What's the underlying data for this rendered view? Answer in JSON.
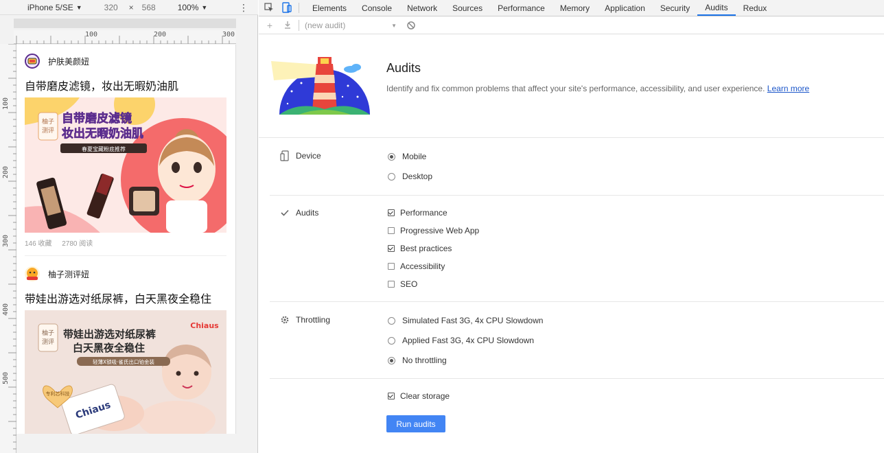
{
  "device_toolbar": {
    "device": "iPhone 5/SE",
    "width": "320",
    "times": "×",
    "height": "568",
    "zoom": "100%"
  },
  "ruler": {
    "h_labels": [
      "100",
      "200",
      "300"
    ],
    "v_labels": [
      "100",
      "200",
      "300",
      "400",
      "500"
    ]
  },
  "articles": [
    {
      "author": "护肤美颜妞",
      "title": "自带磨皮滤镜，妆出无暇奶油肌",
      "image": {
        "badge": "柚子测评",
        "headline_line1": "自带磨皮滤镜",
        "headline_line2": "妆出无暇奶油肌",
        "tagline": "春夏宝藏粉底推荐"
      },
      "stats": {
        "favorites": "146 收藏",
        "reads": "2780 阅读"
      }
    },
    {
      "author": "柚子测评妞",
      "title": "带娃出游选对纸尿裤，白天黑夜全稳住",
      "image": {
        "badge": "柚子测评",
        "brand": "Chiaus",
        "headline_line1": "带娃出游选对纸尿裤",
        "headline_line2": "白天黑夜全稳住",
        "tagline": "轻薄X锁吸·雀氏出口铂金装",
        "seal": "专利芯科技"
      }
    }
  ],
  "devtools": {
    "tabs": [
      "Elements",
      "Console",
      "Network",
      "Sources",
      "Performance",
      "Memory",
      "Application",
      "Security",
      "Audits",
      "Redux"
    ],
    "active_tab": "Audits",
    "audit_select": "(new audit)",
    "title": "Audits",
    "description": "Identify and fix common problems that affect your site's performance, accessibility, and user experience.",
    "learn_more": "Learn more",
    "device_section": {
      "label": "Device",
      "options": [
        {
          "label": "Mobile",
          "selected": true
        },
        {
          "label": "Desktop",
          "selected": false
        }
      ]
    },
    "audits_section": {
      "label": "Audits",
      "options": [
        {
          "label": "Performance",
          "checked": true
        },
        {
          "label": "Progressive Web App",
          "checked": false
        },
        {
          "label": "Best practices",
          "checked": true
        },
        {
          "label": "Accessibility",
          "checked": false
        },
        {
          "label": "SEO",
          "checked": false
        }
      ]
    },
    "throttling_section": {
      "label": "Throttling",
      "options": [
        {
          "label": "Simulated Fast 3G, 4x CPU Slowdown",
          "selected": false
        },
        {
          "label": "Applied Fast 3G, 4x CPU Slowdown",
          "selected": false
        },
        {
          "label": "No throttling",
          "selected": true
        }
      ]
    },
    "clear_storage": {
      "label": "Clear storage",
      "checked": true
    },
    "run_button": "Run audits"
  },
  "colors": {
    "accent": "#1a73e8",
    "button": "#4285f4",
    "link": "#1a55c9"
  }
}
